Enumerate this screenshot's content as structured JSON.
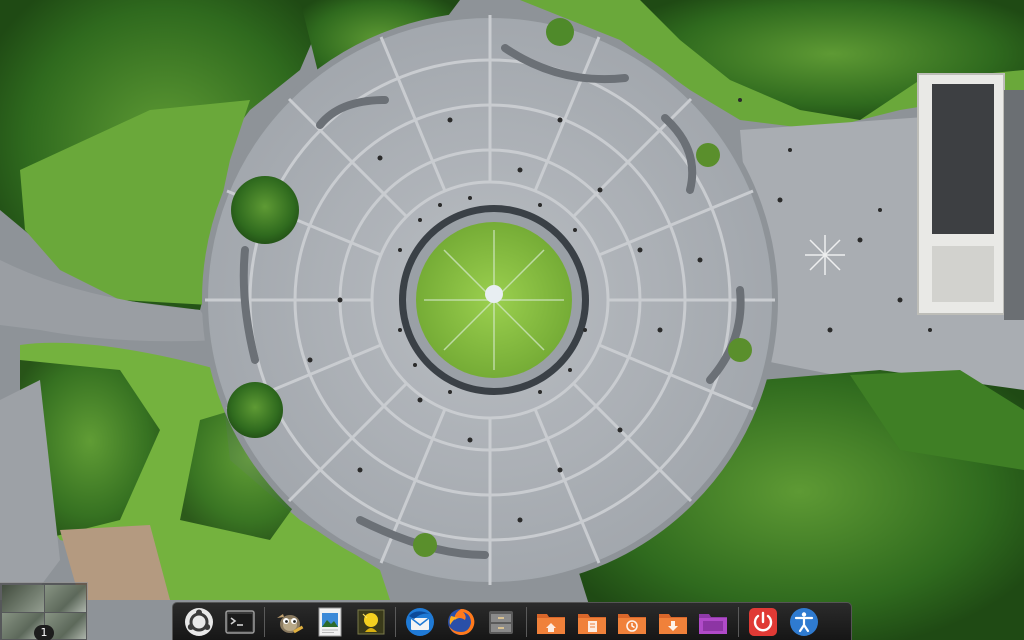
{
  "desktop": {
    "wallpaper": "aerial-park-fountain-plaza"
  },
  "workspace_switcher": {
    "current_workspace": "1"
  },
  "dock": {
    "items": [
      {
        "name": "ubuntu-logo-icon",
        "running": false
      },
      {
        "name": "terminal-icon",
        "running": false
      },
      {
        "name": "gimp-icon",
        "running": false
      },
      {
        "name": "image-viewer-icon",
        "running": false
      },
      {
        "name": "photo-editor-icon",
        "running": false
      },
      {
        "name": "thunderbird-icon",
        "running": false
      },
      {
        "name": "firefox-icon",
        "running": false
      },
      {
        "name": "file-manager-icon",
        "running": false
      },
      {
        "name": "home-folder-icon",
        "running": false
      },
      {
        "name": "documents-folder-icon",
        "running": false
      },
      {
        "name": "recent-folder-icon",
        "running": false
      },
      {
        "name": "downloads-folder-icon",
        "running": false
      },
      {
        "name": "video-folder-icon",
        "running": false
      },
      {
        "name": "power-icon",
        "running": false
      },
      {
        "name": "accessibility-icon",
        "running": false
      }
    ]
  },
  "colors": {
    "dock_background": "#1e1e1e",
    "folder_orange": "#f0813a",
    "power_red": "#e03a35",
    "accessibility_blue": "#2f7bd0",
    "firefox_orange": "#ff7a1c",
    "thunderbird_blue": "#1f7ad6"
  }
}
